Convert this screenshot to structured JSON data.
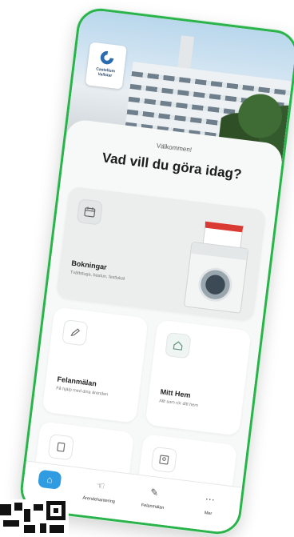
{
  "app": {
    "logo_text": "Castellum Vallstar"
  },
  "header": {
    "welcome": "Välkommen!",
    "headline": "Vad vill du göra idag?"
  },
  "cards": [
    {
      "title": "Bokningar",
      "subtitle": "Tvättstuga, bastun, festlokal"
    },
    {
      "title": "Felanmälan",
      "subtitle": "Få hjälp med dina ärenden"
    },
    {
      "title": "Mitt Hem",
      "subtitle": "Allt som rör ditt hem"
    }
  ],
  "tabs": [
    {
      "label": ""
    },
    {
      "label": "Ärendehantering"
    },
    {
      "label": "Felanmälan"
    },
    {
      "label": "Mer"
    }
  ],
  "icons": {
    "calendar": "calendar-icon",
    "pencil": "pencil-icon",
    "home": "home-icon",
    "brand_color": "#2ab34a",
    "accent": "#2f9be0"
  }
}
